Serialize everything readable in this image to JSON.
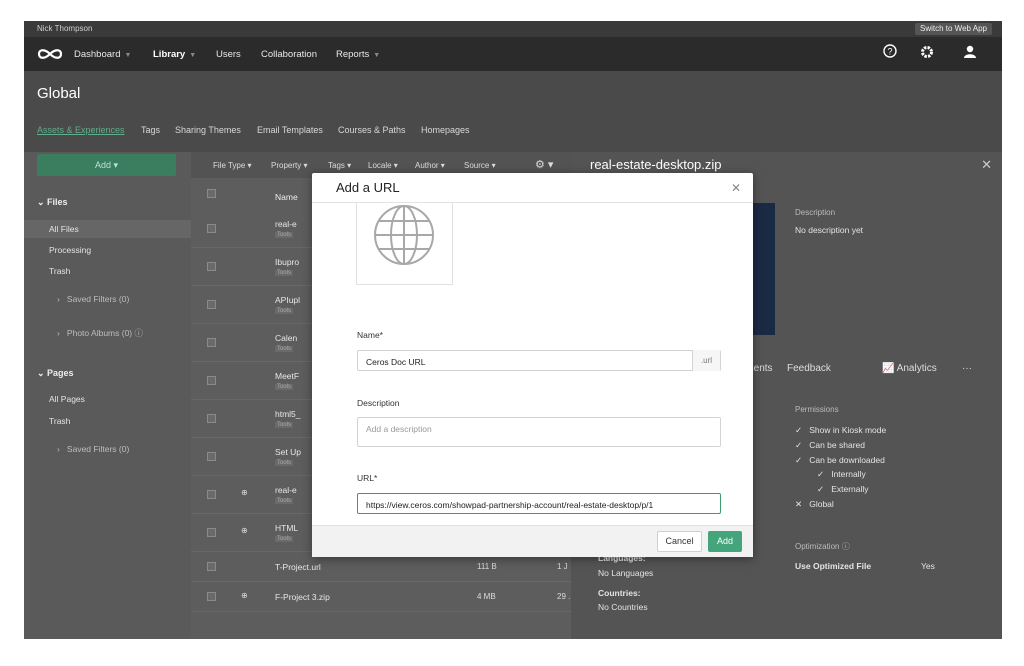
{
  "topstrip": {
    "user": "Nick Thompson",
    "switch_label": "Switch to Web App"
  },
  "nav": {
    "dashboard": "Dashboard",
    "library": "Library",
    "users": "Users",
    "collaboration": "Collaboration",
    "reports": "Reports"
  },
  "page": {
    "title": "Global",
    "tabs": [
      "Assets & Experiences",
      "Tags",
      "Sharing Themes",
      "Email Templates",
      "Courses & Paths",
      "Homepages"
    ]
  },
  "sidebar": {
    "add_label": "Add",
    "files_heading": "Files",
    "all_files": "All Files",
    "processing": "Processing",
    "trash": "Trash",
    "saved_filters": "Saved Filters (0)",
    "photo_albums": "Photo Albums (0)",
    "pages_heading": "Pages",
    "all_pages": "All Pages",
    "pages_trash": "Trash",
    "pages_saved_filters": "Saved Filters (0)"
  },
  "filters": [
    "File Type",
    "Property",
    "Tags",
    "Locale",
    "Author",
    "Source"
  ],
  "table": {
    "name_header": "Name",
    "rows": [
      {
        "name": "real-e",
        "tag": "Tools"
      },
      {
        "name": "Ibupro",
        "tag": "Tools"
      },
      {
        "name": "APIupl",
        "tag": "Tools"
      },
      {
        "name": "Calen",
        "tag": "Tools"
      },
      {
        "name": "MeetF",
        "tag": "Tools"
      },
      {
        "name": "html5_",
        "tag": "Tools"
      },
      {
        "name": "Set Up",
        "tag": "Tools"
      },
      {
        "name": "real-e",
        "tag": "Tools"
      },
      {
        "name": "HTML",
        "tag": "Tools"
      }
    ],
    "row_tp": {
      "name": "T-Project.url",
      "size": "111 B",
      "date": "1 J"
    },
    "row_fp": {
      "name": "F-Project 3.zip",
      "size": "4 MB",
      "date": "29 ."
    }
  },
  "rightpanel": {
    "title": "real-estate-desktop.zip",
    "description_label": "Description",
    "description_value": "No description yet",
    "tab_comments": "mments",
    "tab_feedback": "Feedback",
    "tab_analytics": "Analytics",
    "permissions_label": "Permissions",
    "permissions": [
      "Show in Kiosk mode",
      "Can be shared",
      "Can be downloaded",
      "Internally",
      "Externally",
      "Global"
    ],
    "optimization_label": "Optimization",
    "use_optimized": "Use Optimized File",
    "use_optimized_value": "Yes",
    "languages_label": "Languages:",
    "languages_value": "No Languages",
    "countries_label": "Countries:",
    "countries_value": "No Countries"
  },
  "modal": {
    "title": "Add a URL",
    "name_label": "Name*",
    "name_value": "Ceros Doc URL",
    "name_suffix": ".url",
    "description_label": "Description",
    "description_placeholder": "Add a description",
    "url_label": "URL*",
    "url_value": "https://view.ceros.com/showpad-partnership-account/real-estate-desktop/p/1",
    "cancel_label": "Cancel",
    "add_label": "Add"
  },
  "colors": {
    "accent": "#44a57c",
    "nav": "#2b2b2b"
  }
}
